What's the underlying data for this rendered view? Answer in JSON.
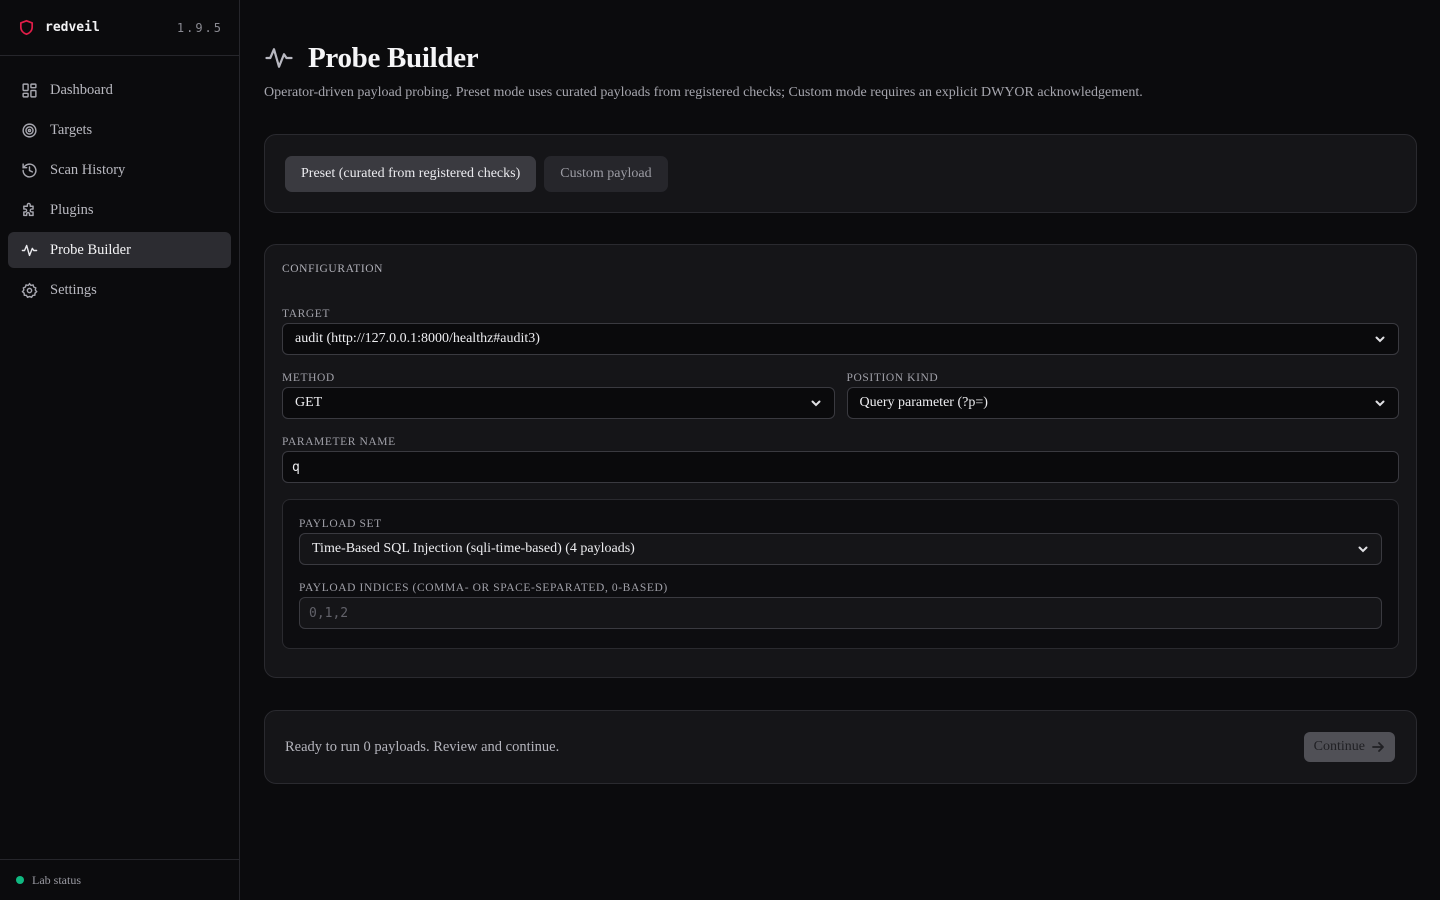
{
  "app": {
    "name": "redveil",
    "version": "1.9.5",
    "brand_color": "#e11d48"
  },
  "sidebar": {
    "items": [
      {
        "label": "Dashboard",
        "icon": "dashboard-icon",
        "active": false
      },
      {
        "label": "Targets",
        "icon": "target-icon",
        "active": false
      },
      {
        "label": "Scan History",
        "icon": "history-icon",
        "active": false
      },
      {
        "label": "Plugins",
        "icon": "puzzle-icon",
        "active": false
      },
      {
        "label": "Probe Builder",
        "icon": "waveform-icon",
        "active": true
      },
      {
        "label": "Settings",
        "icon": "gear-icon",
        "active": false
      }
    ],
    "lab_status": {
      "label": "Lab status",
      "color": "#10b981"
    }
  },
  "page": {
    "title": "Probe Builder",
    "description": "Operator-driven payload probing. Preset mode uses curated payloads from registered checks; Custom mode requires an explicit DWYOR acknowledgement."
  },
  "mode": {
    "preset_label": "Preset (curated from registered checks)",
    "custom_label": "Custom payload",
    "selected": "preset"
  },
  "config": {
    "section_title": "CONFIGURATION",
    "target": {
      "label": "TARGET",
      "value": "audit (http://127.0.0.1:8000/healthz#audit3)"
    },
    "method": {
      "label": "METHOD",
      "value": "GET"
    },
    "position_kind": {
      "label": "POSITION KIND",
      "value": "Query parameter (?p=)"
    },
    "parameter_name": {
      "label": "PARAMETER NAME",
      "value": "q"
    },
    "payload_set": {
      "label": "PAYLOAD SET",
      "value": "Time-Based SQL Injection (sqli-time-based) (4 payloads)"
    },
    "payload_indices": {
      "label": "PAYLOAD INDICES (COMMA- OR SPACE-SEPARATED, 0-BASED)",
      "placeholder": "0,1,2",
      "value": ""
    }
  },
  "footer": {
    "status_text": "Ready to run 0 payloads. Review and continue.",
    "continue_label": "Continue"
  }
}
